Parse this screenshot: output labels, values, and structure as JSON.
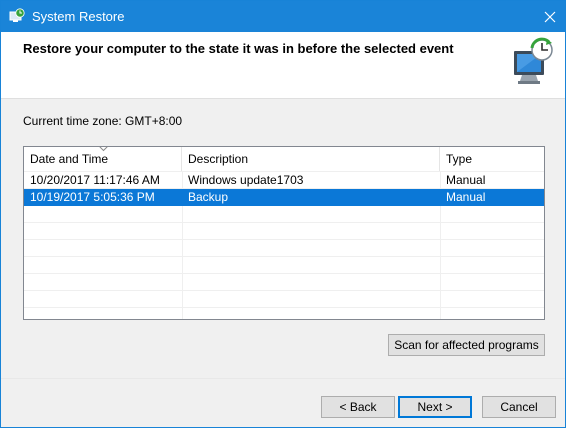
{
  "window": {
    "title": "System Restore",
    "accent": "#1a84d8"
  },
  "header": {
    "text": "Restore your computer to the state it was in before the selected event"
  },
  "timezone": {
    "text": "Current time zone: GMT+8:00"
  },
  "table": {
    "columns": [
      "Date and Time",
      "Description",
      "Type"
    ],
    "sorted_column": "Date and Time",
    "rows": [
      {
        "date": "10/20/2017 11:17:46 AM",
        "description": "Windows update1703",
        "type": "Manual",
        "selected": false
      },
      {
        "date": "10/19/2017 5:05:36 PM",
        "description": "Backup",
        "type": "Manual",
        "selected": true
      }
    ],
    "selection_color": "#0b78d7"
  },
  "buttons": {
    "scan": "Scan for affected programs",
    "back": "< Back",
    "next": "Next >",
    "cancel": "Cancel"
  },
  "icons": {
    "title": "system-restore-icon",
    "header": "computer-restore-icon",
    "close": "close-icon",
    "sort": "sort-descending-icon"
  }
}
